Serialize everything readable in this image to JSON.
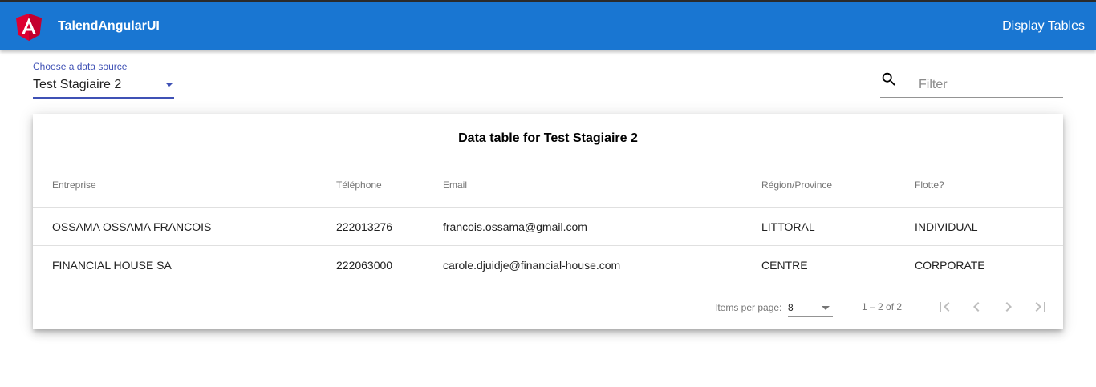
{
  "toolbar": {
    "title": "TalendAngularUI",
    "nav_link": "Display Tables",
    "logo_icon": "angular-logo-icon",
    "background": "#1976d2"
  },
  "source": {
    "label": "Choose a data source",
    "value": "Test Stagiaire 2"
  },
  "filter": {
    "placeholder": "Filter",
    "icon": "search-icon"
  },
  "table": {
    "title": "Data table for Test Stagiaire 2",
    "columns": [
      "Entreprise",
      "Téléphone",
      "Email",
      "Région/Province",
      "Flotte?"
    ],
    "rows": [
      [
        "OSSAMA OSSAMA FRANCOIS",
        "222013276",
        "francois.ossama@gmail.com",
        "LITTORAL",
        "INDIVIDUAL"
      ],
      [
        "FINANCIAL HOUSE SA",
        "222063000",
        "carole.djuidje@financial-house.com",
        "CENTRE",
        "CORPORATE"
      ]
    ]
  },
  "paginator": {
    "items_per_page_label": "Items per page:",
    "items_per_page_value": "8",
    "range_label": "1 – 2 of 2",
    "buttons": [
      "first-page-icon",
      "previous-page-icon",
      "next-page-icon",
      "last-page-icon"
    ]
  }
}
